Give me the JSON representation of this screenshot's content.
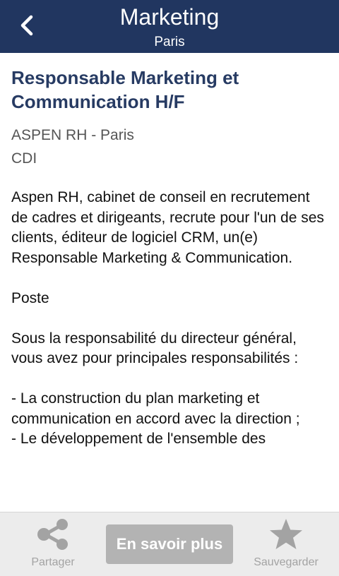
{
  "header": {
    "title": "Marketing",
    "subtitle": "Paris",
    "back_icon": "chevron-left-icon"
  },
  "job": {
    "title": "Responsable Marketing et Communication H/F",
    "company_location": "ASPEN RH - Paris",
    "contract": "CDI",
    "description": "Aspen RH, cabinet de conseil en recrutement de cadres et dirigeants, recrute pour l'un de ses clients, éditeur de logiciel CRM, un(e) Responsable Marketing & Communication.\n\nPoste\n\nSous la responsabilité du directeur général, vous avez pour principales responsabilités :\n\n- La construction du plan marketing et communication en accord avec la direction ;\n- Le développement de l'ensemble des"
  },
  "footer": {
    "share_label": "Partager",
    "share_icon": "share-icon",
    "cta_label": "En savoir plus",
    "save_label": "Sauvegarder",
    "save_icon": "star-icon"
  },
  "colors": {
    "header_bg": "#213660",
    "title_text": "#273b63",
    "footer_bg": "#ececec",
    "cta_bg": "#b3b3b3",
    "icon_gray": "#a3a3a3"
  }
}
